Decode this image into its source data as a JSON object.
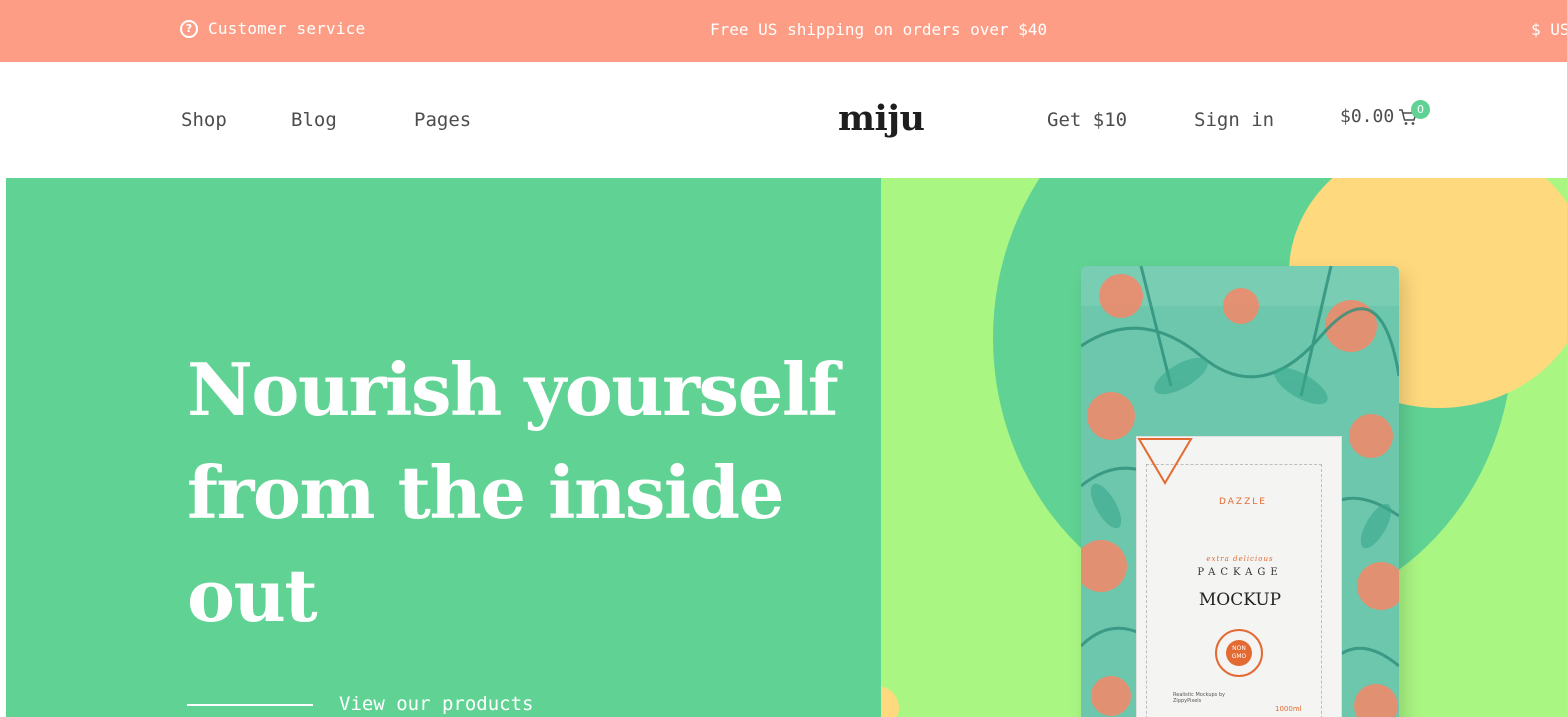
{
  "topbar": {
    "customer_service": "Customer service",
    "customer_service_icon": "question-circle-icon",
    "shipping": "Free US shipping on orders over $40",
    "currency": "$ US"
  },
  "header": {
    "nav": [
      {
        "label": "Shop"
      },
      {
        "label": "Blog"
      },
      {
        "label": "Pages"
      }
    ],
    "logo": "miju",
    "get_offer": "Get $10",
    "sign_in": "Sign in",
    "cart_total": "$0.00",
    "cart_count": "0",
    "cart_icon": "shopping-cart-icon"
  },
  "hero": {
    "headline": "Nourish yourself from the inside out",
    "cta": "View our products",
    "product_image": {
      "brand": "DAZZLE",
      "tagline": "extra delicious",
      "package_word": "PACKAGE",
      "mockup_word": "MOCKUP",
      "seal": "NON GMO",
      "small_text": "Realistic Mockups by ZippyPixels",
      "volume": "1000ml"
    }
  },
  "colors": {
    "topbar_bg": "#fd9d85",
    "hero_green": "#60d394",
    "hero_lime": "#aaf683",
    "accent_yellow": "#ffd97d",
    "badge_green": "#60d394"
  }
}
